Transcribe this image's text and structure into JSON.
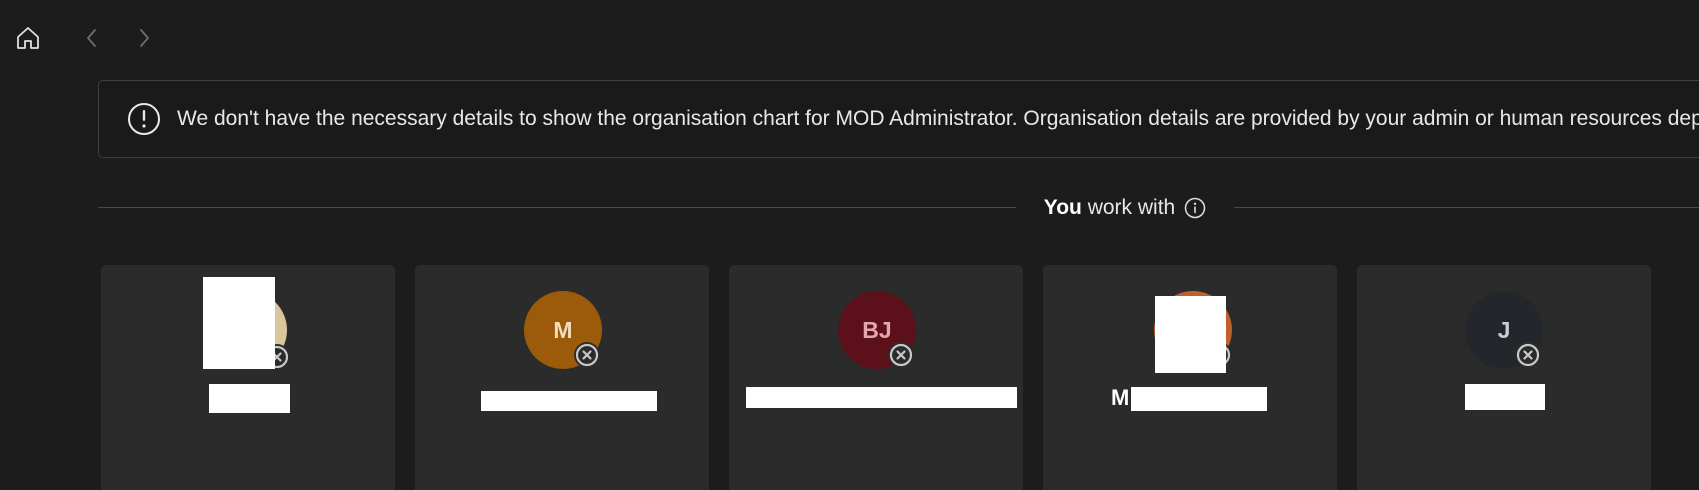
{
  "banner": {
    "message": "We don't have the necessary details to show the organisation chart for MOD Administrator. Organisation details are provided by your admin or human resources department."
  },
  "section": {
    "title_bold": "You",
    "title_rest": " work with"
  },
  "people": [
    {
      "initials": "",
      "avatar_color": "#d8c79a",
      "presence": "offline"
    },
    {
      "initials": "M",
      "avatar_color": "#9b5b0b",
      "presence": "offline"
    },
    {
      "initials": "BJ",
      "avatar_color": "#5c1019",
      "presence": "offline"
    },
    {
      "initials": "",
      "avatar_color": "#c0602c",
      "presence": "offline",
      "name_fragment": "M"
    },
    {
      "initials": "J",
      "avatar_color": "#23272b",
      "presence": "offline"
    }
  ],
  "icons": {
    "home": "home-icon",
    "back": "chevron-left-icon",
    "forward": "chevron-right-icon",
    "alert": "exclamation-circle-icon",
    "info": "info-circle-icon",
    "presence": "presence-offline-icon"
  }
}
